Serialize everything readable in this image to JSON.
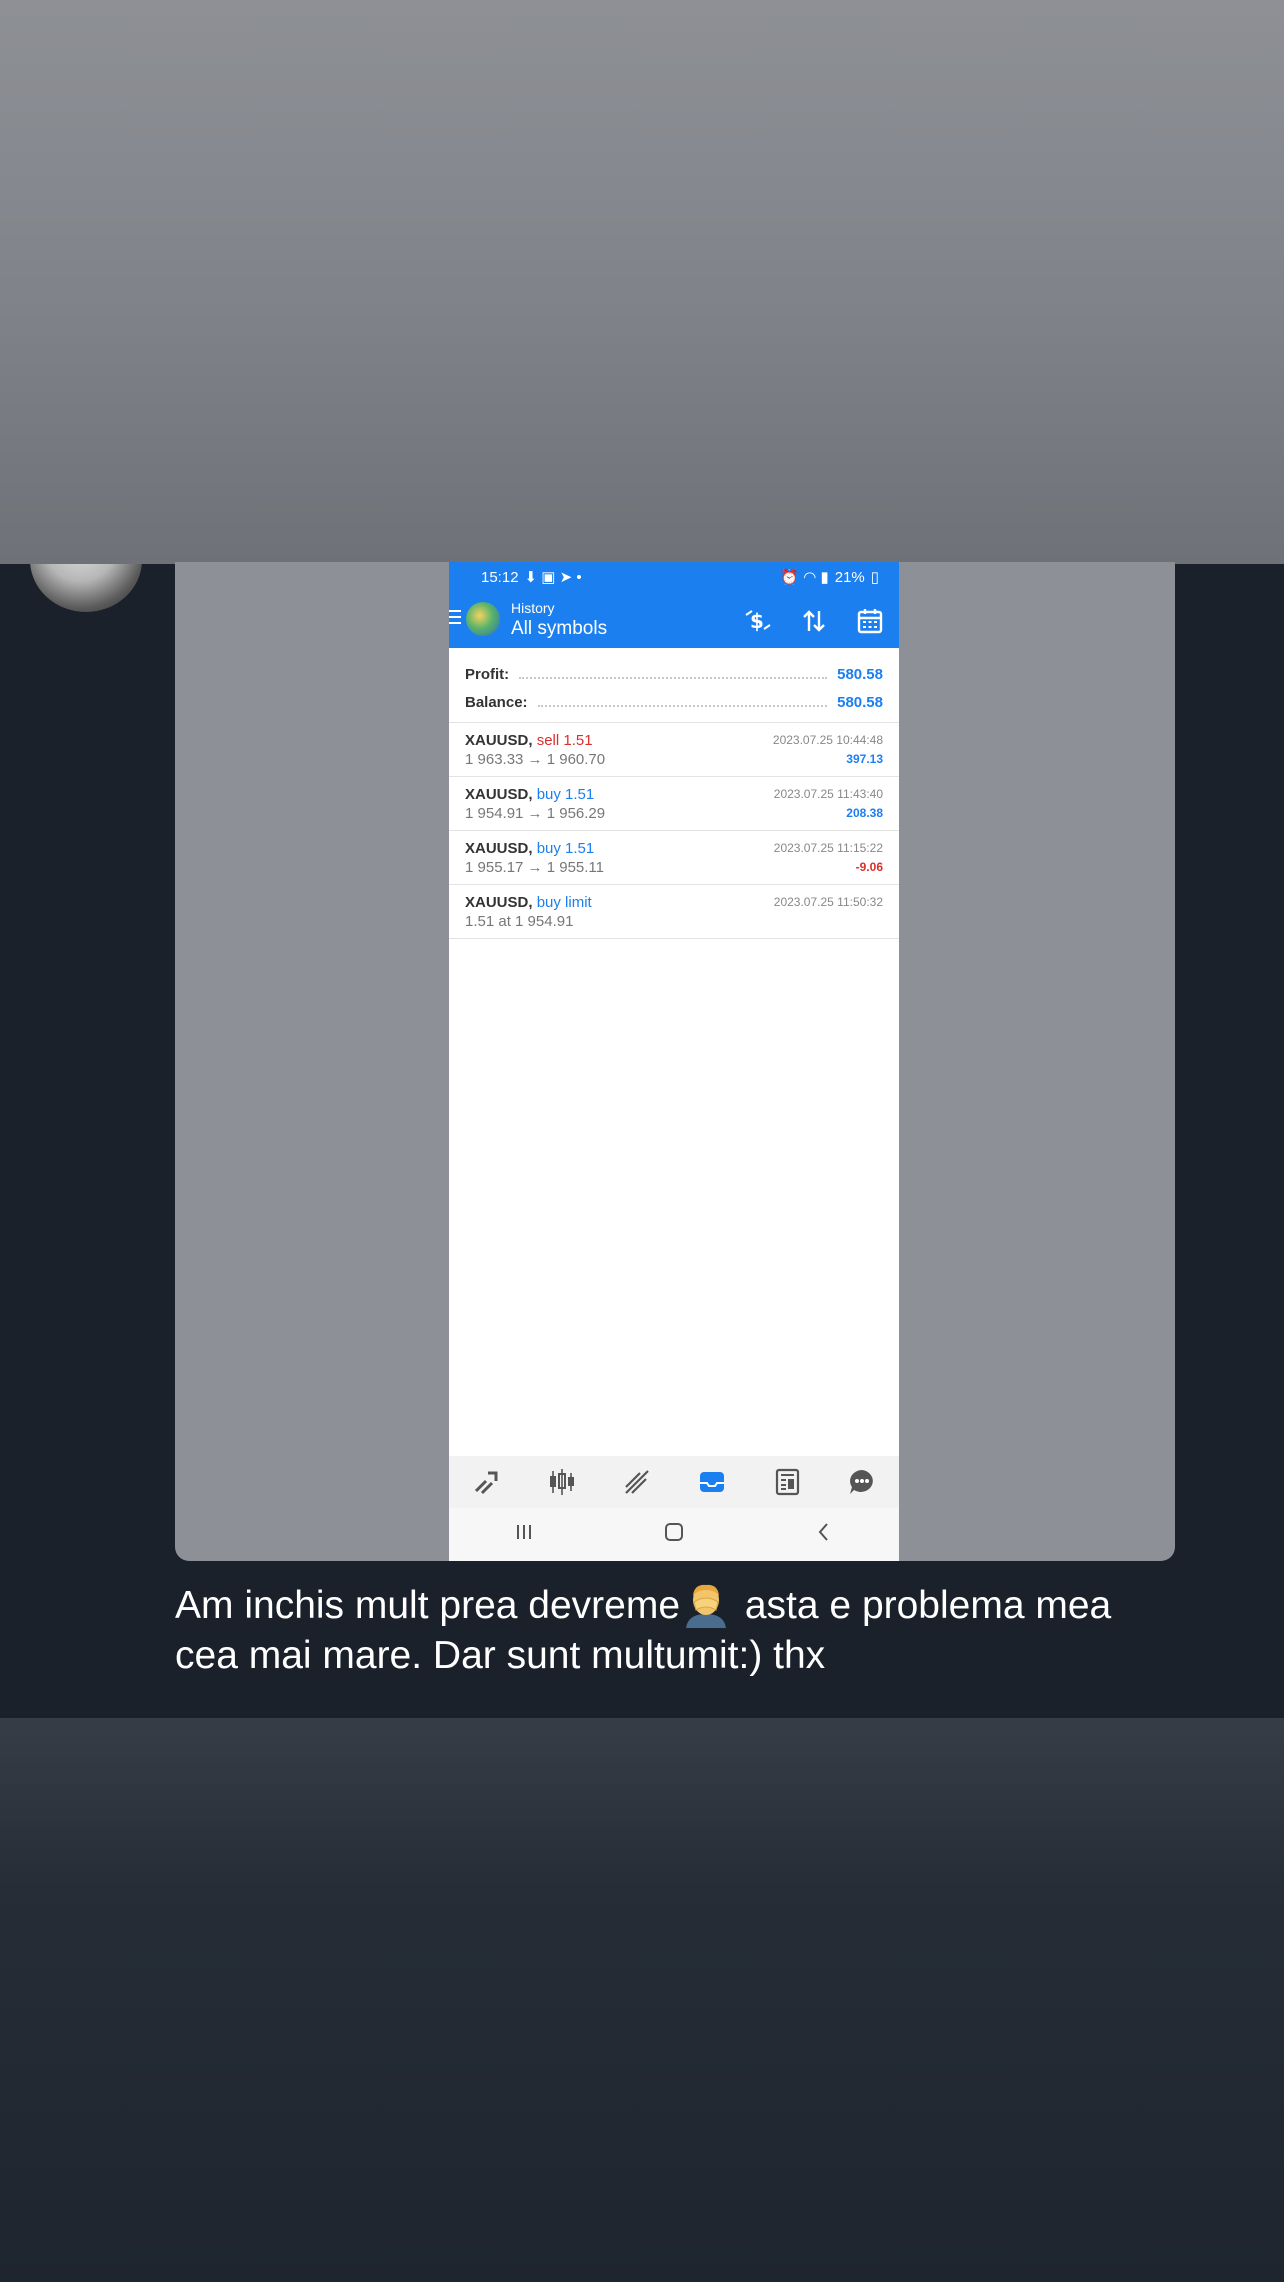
{
  "phone": {
    "status_time": "15:12",
    "status_battery": "21%",
    "appbar_subtitle": "History",
    "appbar_title": "All symbols",
    "summary": {
      "profit_label": "Profit:",
      "profit_value": "580.58",
      "balance_label": "Balance:",
      "balance_value": "580.58"
    },
    "deals": [
      {
        "symbol": "XAUUSD,",
        "action": "sell 1.51",
        "prices": "1 963.33 → 1 960.70",
        "time": "2023.07.25 10:44:48",
        "profit": "397.13"
      },
      {
        "symbol": "XAUUSD,",
        "action": "buy 1.51",
        "prices": "1 954.91 → 1 956.29",
        "time": "2023.07.25 11:43:40",
        "profit": "208.38"
      },
      {
        "symbol": "XAUUSD,",
        "action": "buy 1.51",
        "prices": "1 955.17 → 1 955.11",
        "time": "2023.07.25 11:15:22",
        "profit": "-9.06"
      },
      {
        "symbol": "XAUUSD,",
        "action": "buy limit",
        "prices": "1.51 at 1 954.91",
        "time": "2023.07.25 11:50:32",
        "profit": ""
      }
    ],
    "bottom_nav": [
      "quotes-icon",
      "chart-candles-icon",
      "trade-icon",
      "history-icon",
      "news-icon",
      "chat-icon"
    ],
    "accent_color": "#1c7ff0",
    "loss_color": "#d9302c"
  },
  "caption": {
    "line_part1": "Am inchis mult prea devreme",
    "line_part2": " asta e problema mea cea mai mare. Dar sunt multumit:) thx",
    "emoji": "face-palm-emoji"
  }
}
